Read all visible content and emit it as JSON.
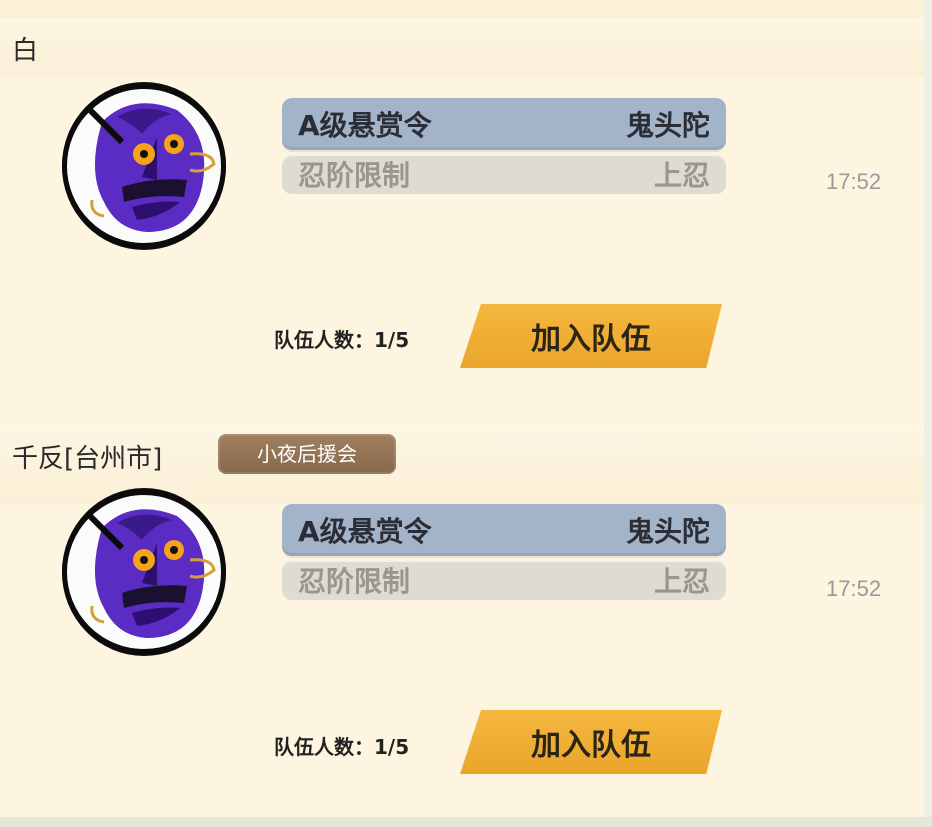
{
  "messages": [
    {
      "sender": "白",
      "guild": "",
      "bounty_title": "A级悬赏令",
      "bounty_target": "鬼头陀",
      "rank_label": "忍阶限制",
      "rank_value": "上忍",
      "time": "17:52",
      "team_count_label": "队伍人数：1/5",
      "join_label": "加入队伍"
    },
    {
      "sender": "千反[台州市]",
      "guild": "小夜后援会",
      "bounty_title": "A级悬赏令",
      "bounty_target": "鬼头陀",
      "rank_label": "忍阶限制",
      "rank_value": "上忍",
      "time": "17:52",
      "team_count_label": "队伍人数：1/5",
      "join_label": "加入队伍"
    }
  ],
  "icons": {
    "avatar": "purple-oni-mask-icon"
  },
  "colors": {
    "background": "#fdf5e0",
    "bounty_row": "#a3b4c9",
    "rank_row": "#dedcd2",
    "join_button": "#f5b73e",
    "guild_badge": "#8f7050"
  }
}
